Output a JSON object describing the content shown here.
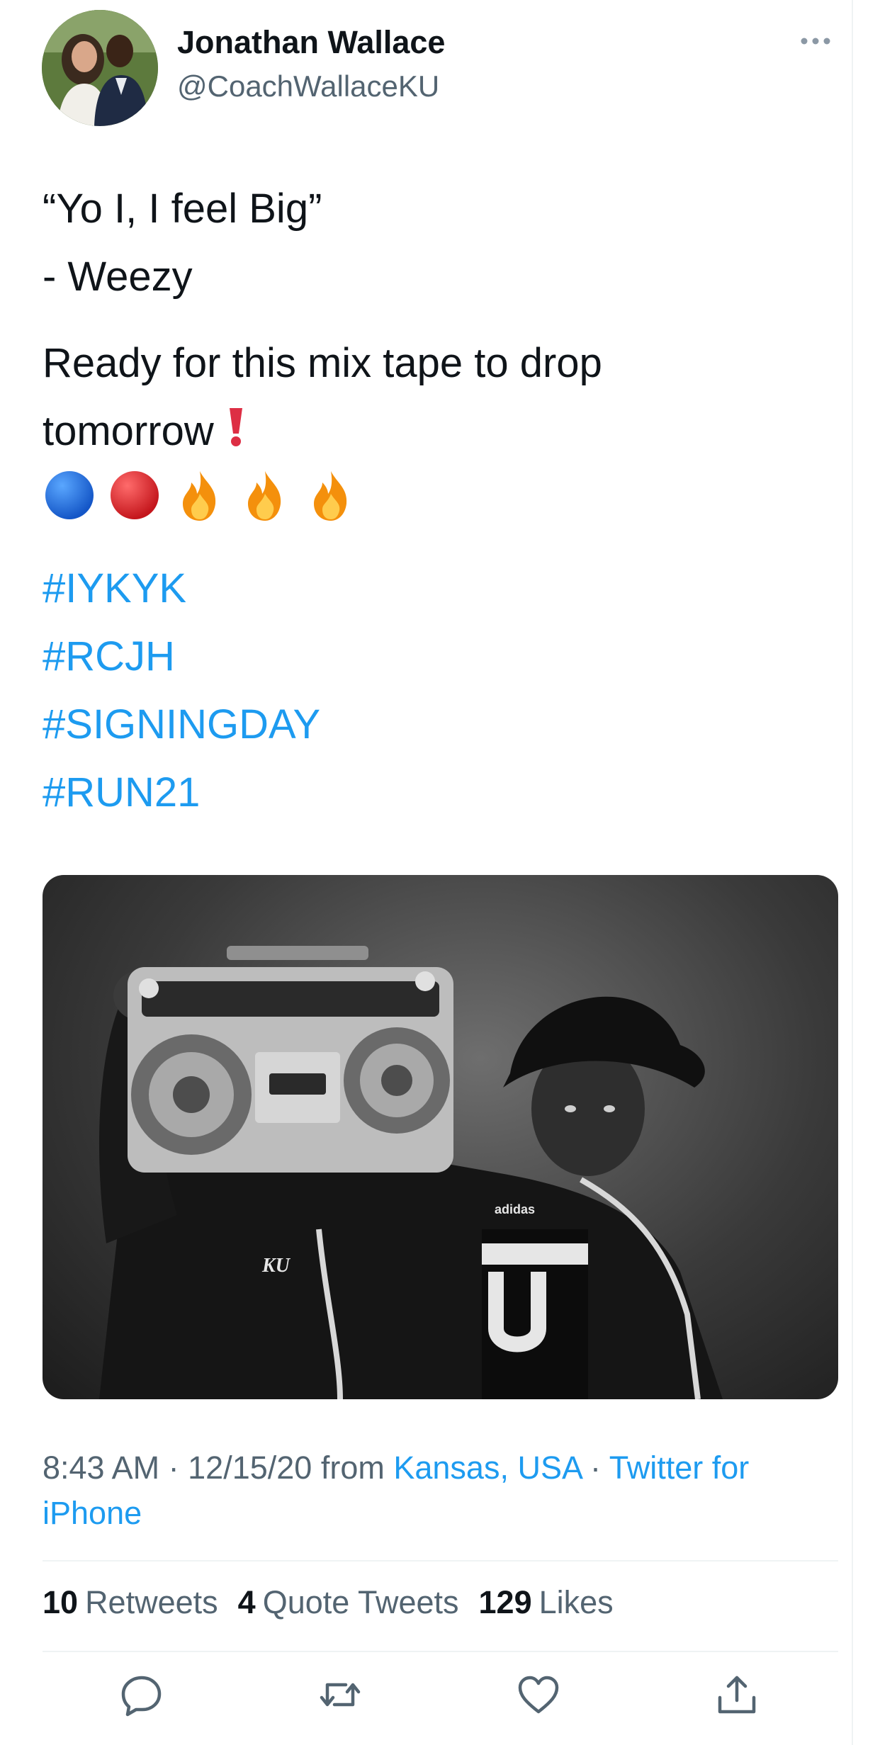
{
  "author": {
    "name": "Jonathan Wallace",
    "handle": "@CoachWallaceKU",
    "avatar_icon": "couple-photo-avatar"
  },
  "tweet": {
    "lines": [
      "“Yo I, I feel Big”",
      "- Weezy",
      "Ready for this mix tape to drop",
      "tomorrow"
    ],
    "exclamation_emoji": "❗",
    "emojis": [
      "🔵",
      "🔴",
      "🔥",
      "🔥",
      "🔥"
    ],
    "hashtags": [
      "#IYKYK",
      "#RCJH",
      "#SIGNINGDAY",
      "#RUN21"
    ]
  },
  "media": {
    "description_icon": "photo-man-with-boombox",
    "labels": [
      "KU",
      "adidas"
    ]
  },
  "meta": {
    "time": "8:43 AM",
    "date": "12/15/20",
    "from_word": "from",
    "location": "Kansas, USA",
    "separator": "·",
    "client_part1": "Twitter for",
    "client_part2": "iPhone"
  },
  "stats": {
    "retweets_count": "10",
    "retweets_label": "Retweets",
    "quotes_count": "4",
    "quotes_label": "Quote Tweets",
    "likes_count": "129",
    "likes_label": "Likes"
  },
  "actions": [
    "reply-icon",
    "retweet-icon",
    "like-icon",
    "share-icon"
  ],
  "colors": {
    "link": "#1d9bf0",
    "text": "#0f1419",
    "secondary": "#536471",
    "divider": "#eff3f4"
  }
}
